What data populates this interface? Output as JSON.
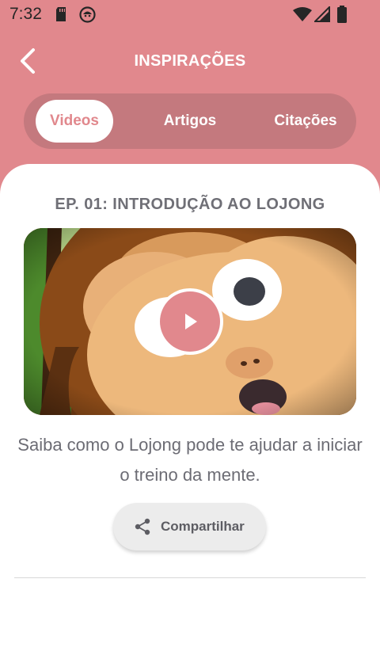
{
  "status": {
    "time": "7:32"
  },
  "header": {
    "title": "INSPIRAÇÕES"
  },
  "tabs": [
    {
      "label": "Videos",
      "active": true
    },
    {
      "label": "Artigos",
      "active": false
    },
    {
      "label": "Citações",
      "active": false
    }
  ],
  "episode": {
    "title": "EP. 01: INTRODUÇÃO AO LOJONG",
    "description": "Saiba como o Lojong pode te ajudar a iniciar o treino da mente.",
    "share_label": "Compartilhar"
  },
  "colors": {
    "brand": "#e1888d",
    "tab_track": "#c4797e",
    "text": "#6c6c74"
  },
  "icons": [
    "sd-card-icon",
    "status-face-icon",
    "wifi-icon",
    "signal-icon",
    "battery-icon",
    "back-arrow-icon",
    "play-icon",
    "share-icon"
  ]
}
